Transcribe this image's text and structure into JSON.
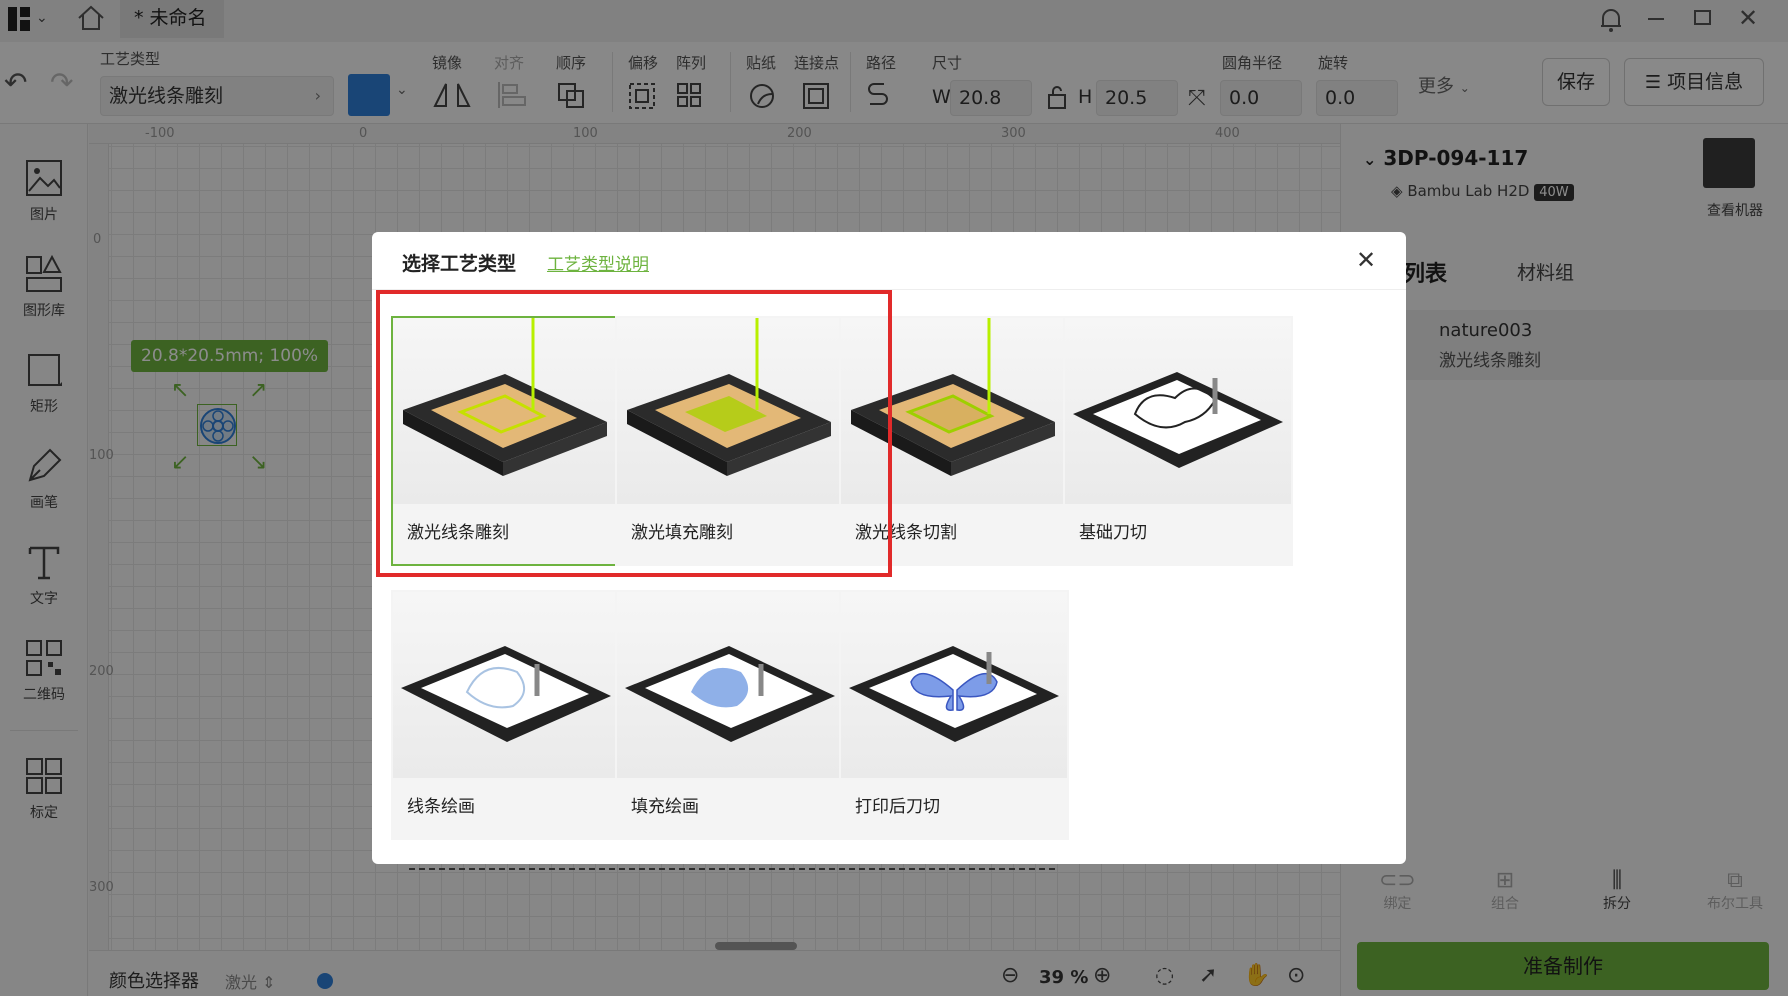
{
  "titlebar": {
    "tab": "* 未命名"
  },
  "toolbar": {
    "process_label": "工艺类型",
    "process_value": "激光线条雕刻",
    "mirror": "镜像",
    "align": "对齐",
    "order": "顺序",
    "offset": "偏移",
    "array": "阵列",
    "sticker": "贴纸",
    "connect": "连接点",
    "path": "路径",
    "size": "尺寸",
    "w_label": "W",
    "w": "20.8",
    "h_label": "H",
    "h": "20.5",
    "radius_label": "圆角半径",
    "radius": "0.0",
    "rotate_label": "旋转",
    "rotate": "0.0",
    "more": "更多",
    "save": "保存",
    "project_info": "项目信息"
  },
  "colors": {
    "accent": "#6db33f",
    "blue": "#2f7ed8",
    "highlight": "#e12a2a"
  },
  "leftbar": [
    {
      "label": "图片",
      "icon": "image-icon"
    },
    {
      "label": "图形库",
      "icon": "shapes-icon"
    },
    {
      "label": "矩形",
      "icon": "rectangle-icon"
    },
    {
      "label": "画笔",
      "icon": "pen-icon"
    },
    {
      "label": "文字",
      "icon": "text-icon"
    },
    {
      "label": "二维码",
      "icon": "qrcode-icon"
    },
    {
      "label": "标定",
      "icon": "calibrate-icon"
    }
  ],
  "rulers": {
    "h": [
      "-100",
      "0",
      "100",
      "200",
      "300",
      "400"
    ],
    "v": [
      "0",
      "100",
      "200",
      "300"
    ]
  },
  "canvas": {
    "size_tag": "20.8*20.5mm; 100%"
  },
  "right": {
    "device": "3DP-094-117",
    "model": "Bambu Lab H2D",
    "power": "40W",
    "view_machine": "查看机器",
    "tab1": "表列表",
    "tab1_visible": "列表",
    "tab2": "材料组",
    "item_name": "nature003",
    "item_process": "激光线条雕刻",
    "tools": [
      "绑定",
      "组合",
      "拆分",
      "布尔工具"
    ],
    "ready": "准备制作"
  },
  "bottom": {
    "color_picker": "颜色选择器",
    "mode": "激光",
    "zoom": "39 %"
  },
  "dialog": {
    "title": "选择工艺类型",
    "link": "工艺类型说明",
    "cards": [
      "激光线条雕刻",
      "激光填充雕刻",
      "激光线条切割",
      "基础刀切",
      "线条绘画",
      "填充绘画",
      "打印后刀切"
    ]
  }
}
